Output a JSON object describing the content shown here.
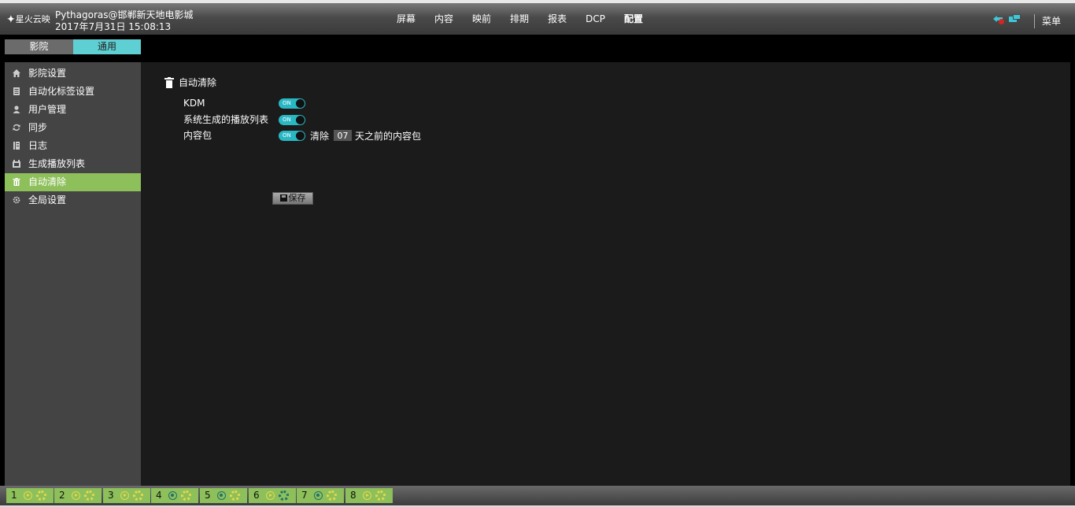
{
  "header": {
    "logo_text": "星火云映",
    "account": "Pythagoras@邯郸新天地电影城",
    "datetime": "2017年7月31日 15:08:13",
    "nav": [
      "屏幕",
      "内容",
      "映前",
      "排期",
      "报表",
      "DCP",
      "配置"
    ],
    "nav_active": "配置",
    "menu_label": "菜单"
  },
  "tabs": {
    "cinema": "影院",
    "general": "通用",
    "active": "通用"
  },
  "sidebar": {
    "items": [
      {
        "label": "影院设置",
        "icon": "home-icon"
      },
      {
        "label": "自动化标签设置",
        "icon": "tag-icon"
      },
      {
        "label": "用户管理",
        "icon": "user-icon"
      },
      {
        "label": "同步",
        "icon": "sync-icon"
      },
      {
        "label": "日志",
        "icon": "log-icon"
      },
      {
        "label": "生成播放列表",
        "icon": "playlist-icon"
      },
      {
        "label": "自动清除",
        "icon": "trash-icon"
      },
      {
        "label": "全局设置",
        "icon": "settings-icon"
      }
    ],
    "active": "自动清除"
  },
  "auto_clean": {
    "title": "自动清除",
    "rows": [
      {
        "label": "KDM",
        "toggle": "ON"
      },
      {
        "label": "系统生成的播放列表",
        "toggle": "ON"
      },
      {
        "label": "内容包",
        "toggle": "ON"
      }
    ],
    "clean_prefix": "清除",
    "days": "07",
    "clean_suffix": "天之前的内容包",
    "save_label": "保存"
  },
  "screens": [
    {
      "num": "1",
      "status": "play",
      "gear": "yellow"
    },
    {
      "num": "2",
      "status": "play",
      "gear": "yellow"
    },
    {
      "num": "3",
      "status": "play",
      "gear": "yellow"
    },
    {
      "num": "4",
      "status": "stop",
      "gear": "yellow"
    },
    {
      "num": "5",
      "status": "stop",
      "gear": "yellow"
    },
    {
      "num": "6",
      "status": "play",
      "gear": "teal"
    },
    {
      "num": "7",
      "status": "stop",
      "gear": "yellow"
    },
    {
      "num": "8",
      "status": "play",
      "gear": "yellow"
    }
  ],
  "colors": {
    "accent_teal": "#5ecfd3",
    "active_green": "#8dbf5a",
    "toggle_on": "#2ab7c4"
  }
}
